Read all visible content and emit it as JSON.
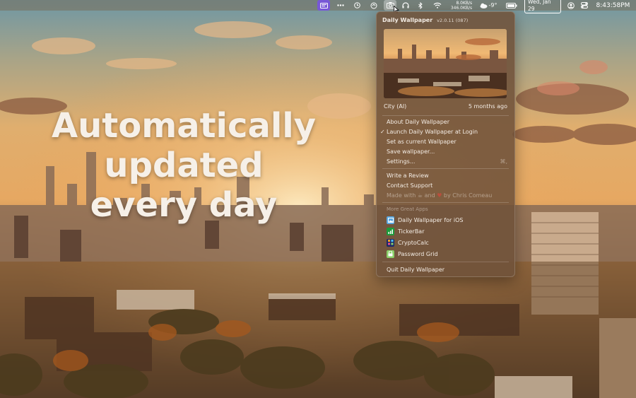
{
  "wallpaper": {
    "headline": [
      "Automatically",
      "updated",
      "every day"
    ]
  },
  "menubar": {
    "net_up": "8.0KB/s",
    "net_down": "346.0KB/s",
    "weather_temp": "-9°",
    "date": "Wed, Jan 29",
    "time": "8:43:58PM"
  },
  "menu": {
    "app_name": "Daily Wallpaper",
    "version": "v2.0.11 (087)",
    "wallpaper_title": "City (AI)",
    "wallpaper_age": "5 months ago",
    "items": {
      "about": "About Daily Wallpaper",
      "launch_at_login": "Launch Daily Wallpaper at Login",
      "set_current": "Set as current Wallpaper",
      "save": "Save wallpaper...",
      "settings": "Settings...",
      "settings_shortcut": "⌘,",
      "write_review": "Write a Review",
      "contact_support": "Contact Support",
      "made_with_prefix": "Made with",
      "made_with_and": "and",
      "made_with_by": "by Chris Comeau",
      "quit": "Quit Daily Wallpaper"
    },
    "more_apps_label": "More Great Apps",
    "more_apps": [
      {
        "name": "Daily Wallpaper for iOS",
        "icon": "image-icon",
        "color": "#5aa7e0"
      },
      {
        "name": "TickerBar",
        "icon": "chart-icon",
        "color": "#1c9a3a"
      },
      {
        "name": "CryptoCalc",
        "icon": "grid-icon",
        "color": "#1a2a6a"
      },
      {
        "name": "Password Grid",
        "icon": "lock-icon",
        "color": "#8bd16a"
      }
    ]
  }
}
